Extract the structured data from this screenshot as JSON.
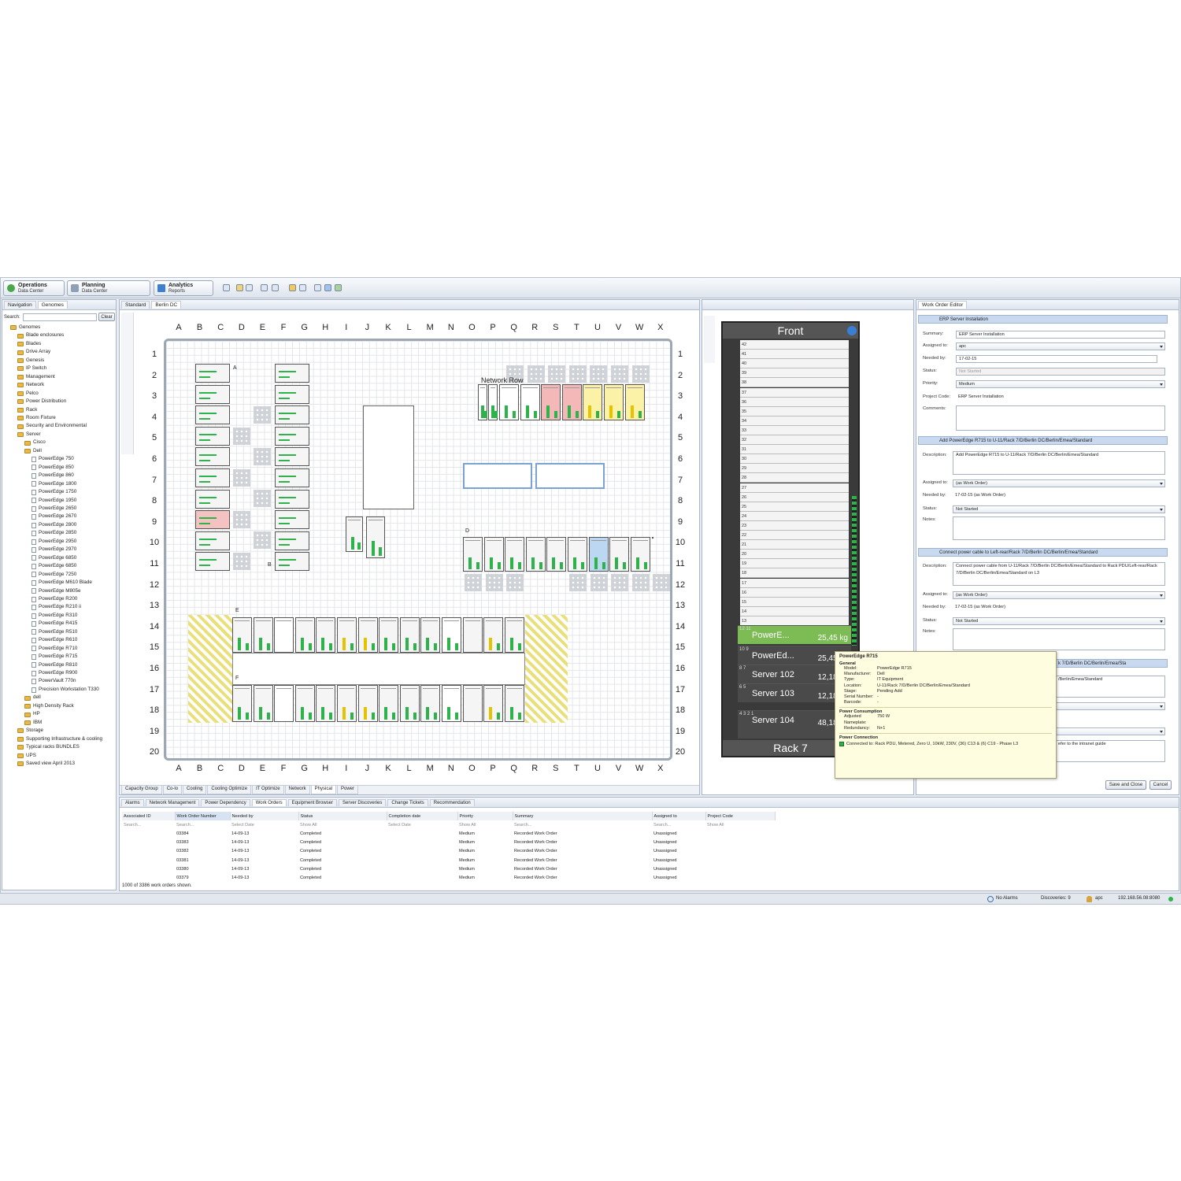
{
  "toolbar": {
    "perspectives": [
      {
        "title": "Operations",
        "sub": "Data Center"
      },
      {
        "title": "Planning",
        "sub": "Data Center"
      },
      {
        "title": "Analytics",
        "sub": "Reports"
      }
    ]
  },
  "nav": {
    "tabs": [
      "Navigation",
      "Genomes"
    ],
    "search_label": "Search:",
    "clear": "Clear",
    "tree": [
      {
        "l": "Genomes",
        "d": 0,
        "t": "f"
      },
      {
        "l": "Blade enclosures",
        "d": 1,
        "t": "f"
      },
      {
        "l": "Blades",
        "d": 1,
        "t": "f"
      },
      {
        "l": "Drive Array",
        "d": 1,
        "t": "f"
      },
      {
        "l": "Genesis",
        "d": 1,
        "t": "f"
      },
      {
        "l": "IP Switch",
        "d": 1,
        "t": "f"
      },
      {
        "l": "Management",
        "d": 1,
        "t": "f"
      },
      {
        "l": "Network",
        "d": 1,
        "t": "f"
      },
      {
        "l": "Pelco",
        "d": 1,
        "t": "f"
      },
      {
        "l": "Power Distribution",
        "d": 1,
        "t": "f"
      },
      {
        "l": "Rack",
        "d": 1,
        "t": "f"
      },
      {
        "l": "Room Fixture",
        "d": 1,
        "t": "f"
      },
      {
        "l": "Security and Environmental",
        "d": 1,
        "t": "f"
      },
      {
        "l": "Server",
        "d": 1,
        "t": "f"
      },
      {
        "l": "Cisco",
        "d": 2,
        "t": "f"
      },
      {
        "l": "Dell",
        "d": 2,
        "t": "f"
      },
      {
        "l": "PowerEdge 750",
        "d": 3,
        "t": "d"
      },
      {
        "l": "PowerEdge 850",
        "d": 3,
        "t": "d"
      },
      {
        "l": "PowerEdge 860",
        "d": 3,
        "t": "d"
      },
      {
        "l": "PowerEdge 1800",
        "d": 3,
        "t": "d"
      },
      {
        "l": "PowerEdge 1750",
        "d": 3,
        "t": "d"
      },
      {
        "l": "PowerEdge 1950",
        "d": 3,
        "t": "d"
      },
      {
        "l": "PowerEdge 2650",
        "d": 3,
        "t": "d"
      },
      {
        "l": "PowerEdge 2670",
        "d": 3,
        "t": "d"
      },
      {
        "l": "PowerEdge 2800",
        "d": 3,
        "t": "d"
      },
      {
        "l": "PowerEdge 2850",
        "d": 3,
        "t": "d"
      },
      {
        "l": "PowerEdge 2950",
        "d": 3,
        "t": "d"
      },
      {
        "l": "PowerEdge 2970",
        "d": 3,
        "t": "d"
      },
      {
        "l": "PowerEdge 6850",
        "d": 3,
        "t": "d"
      },
      {
        "l": "PowerEdge 6850",
        "d": 3,
        "t": "d"
      },
      {
        "l": "PowerEdge 7250",
        "d": 3,
        "t": "d"
      },
      {
        "l": "PowerEdge M610 Blade",
        "d": 3,
        "t": "d"
      },
      {
        "l": "PowerEdge M805e",
        "d": 3,
        "t": "d"
      },
      {
        "l": "PowerEdge R200",
        "d": 3,
        "t": "d"
      },
      {
        "l": "PowerEdge R210 ii",
        "d": 3,
        "t": "d"
      },
      {
        "l": "PowerEdge R310",
        "d": 3,
        "t": "d"
      },
      {
        "l": "PowerEdge R415",
        "d": 3,
        "t": "d"
      },
      {
        "l": "PowerEdge R510",
        "d": 3,
        "t": "d"
      },
      {
        "l": "PowerEdge R610",
        "d": 3,
        "t": "d"
      },
      {
        "l": "PowerEdge R710",
        "d": 3,
        "t": "d"
      },
      {
        "l": "PowerEdge R715",
        "d": 3,
        "t": "d"
      },
      {
        "l": "PowerEdge R810",
        "d": 3,
        "t": "d"
      },
      {
        "l": "PowerEdge R900",
        "d": 3,
        "t": "d"
      },
      {
        "l": "PowerVault 770n",
        "d": 3,
        "t": "d"
      },
      {
        "l": "Precision Workstation T330",
        "d": 3,
        "t": "d"
      },
      {
        "l": "dell",
        "d": 2,
        "t": "f"
      },
      {
        "l": "High Density Rack",
        "d": 2,
        "t": "f"
      },
      {
        "l": "HP",
        "d": 2,
        "t": "f"
      },
      {
        "l": "IBM",
        "d": 2,
        "t": "f"
      },
      {
        "l": "Storage",
        "d": 1,
        "t": "f"
      },
      {
        "l": "Supporting Infrastructure & cooling",
        "d": 1,
        "t": "f"
      },
      {
        "l": "Typical racks BUNDLES",
        "d": 1,
        "t": "f"
      },
      {
        "l": "UPS",
        "d": 1,
        "t": "f"
      },
      {
        "l": "Saved view April 2013",
        "d": 1,
        "t": "f"
      }
    ]
  },
  "editor": {
    "tabs": [
      "Standard",
      "Berlin DC"
    ],
    "columns": [
      "A",
      "B",
      "C",
      "D",
      "E",
      "F",
      "G",
      "H",
      "I",
      "J",
      "K",
      "L",
      "M",
      "N",
      "O",
      "P",
      "Q",
      "R",
      "S",
      "T",
      "U",
      "V",
      "W",
      "X"
    ],
    "rows": [
      "1",
      "2",
      "3",
      "4",
      "5",
      "6",
      "7",
      "8",
      "9",
      "10",
      "11",
      "12",
      "13",
      "14",
      "15",
      "16",
      "17",
      "18",
      "19",
      "20"
    ],
    "row_labels": {
      "a": "A",
      "b": "B",
      "c": "C",
      "d": "D",
      "e": "E",
      "f": "F"
    },
    "network_row": "Network Row",
    "bottom_tabs": [
      "Capacity Group",
      "Co-lo",
      "Cooling",
      "Cooling Optimize",
      "IT Optimize",
      "Network",
      "Physical",
      "Power"
    ]
  },
  "rack": {
    "header": "Front",
    "footer": "Rack 7",
    "units": [
      "42",
      "41",
      "40",
      "39",
      "38",
      "37",
      "36",
      "35",
      "34",
      "33",
      "32",
      "31",
      "30",
      "29",
      "28",
      "27",
      "26",
      "25",
      "24",
      "23",
      "22",
      "21",
      "20",
      "19",
      "18",
      "17",
      "16",
      "15",
      "14",
      "13"
    ],
    "servers": [
      {
        "name": "PowerE...",
        "weight": "25,45 kg",
        "units": "12 11",
        "color": "#7dbb55"
      },
      {
        "name": "PowerEd...",
        "weight": "25,45 kg",
        "units": "10 9",
        "color": "#4a4a4a"
      },
      {
        "name": "Server 102",
        "weight": "12,18 kg",
        "units": "8 7",
        "color": "#4a4a4a"
      },
      {
        "name": "Server 103",
        "weight": "12,18 kg",
        "units": "6 5",
        "color": "#4a4a4a"
      },
      {
        "name": "Server 104",
        "weight": "48,18 kg",
        "units": "4 3 2 1",
        "color": "#4a4a4a"
      }
    ]
  },
  "tooltip": {
    "title": "PowerEdge R715",
    "general": "General",
    "fields": [
      {
        "k": "Model:",
        "v": "PowerEdge R715"
      },
      {
        "k": "Manufacturer:",
        "v": "Dell"
      },
      {
        "k": "Type:",
        "v": "IT Equipment"
      },
      {
        "k": "Location:",
        "v": "U-11/Rack 7/D/Berlin DC/Berlin/Emea/Standard"
      },
      {
        "k": "Stage:",
        "v": "Pending Add"
      },
      {
        "k": "Serial Number:",
        "v": "-"
      },
      {
        "k": "Barcode:",
        "v": "-"
      }
    ],
    "power_consumption": "Power Consumption",
    "power_fields": [
      {
        "k": "Adjusted Nameplate:",
        "v": "750 W"
      },
      {
        "k": "Redundancy:",
        "v": "N+1"
      }
    ],
    "power_connection": "Power Connection",
    "connection": "Connected to: Rack PDU, Metered, Zero U, 10kW, 230V, (36) C13 & (6) C19 - Phase L3"
  },
  "work_order_editor": {
    "tab": "Work Order Editor",
    "section1": "ERP Server Installation",
    "summary_label": "Summary:",
    "summary": "ERP Server Installation",
    "assigned_label": "Assigned to:",
    "assigned": "apc",
    "needed_label": "Needed by:",
    "needed": "17-02-15",
    "status_label": "Status:",
    "status": "Not Started",
    "priority_label": "Priority:",
    "priority": "Medium",
    "project_label": "Project Code:",
    "project": "ERP Server Installation",
    "comments_label": "Comments:",
    "section2": "Add PowerEdge R715 to U-11/Rack 7/D/Berlin DC/Berlin/Emea/Standard",
    "desc_label": "Description:",
    "desc2": "Add PowerEdge R715 to U-11/Rack 7/D/Berlin DC/Berlin/Emea/Standard",
    "assigned2": "(as Work Order)",
    "needed2": "17-02-15 (as Work Order)",
    "status2": "Not Started",
    "notes_label": "Notes:",
    "section3": "Connect power cable to Left-rear/Rack 7/D/Berlin DC/Berlin/Emea/Standard",
    "desc3": "Connect power cable from U-11/Rack 7/D/Berlin DC/Berlin/Emea/Standard to Rack PDU/Left-rear/Rack 7/D/Berlin DC/Berlin/Emea/Standard on L3",
    "section4_tail": "k 7/D/Berlin DC/Berlin/Emea/Sta",
    "desc4_tail": "/Berlin/Emea/Standard",
    "note4_tail": "efer to the intranet guide",
    "save_close": "Save and Close",
    "cancel": "Cancel"
  },
  "bottom": {
    "tabs": [
      "Alarms",
      "Network Management",
      "Power Dependency",
      "Work Orders",
      "Equipment Browser",
      "Server Discoveries",
      "Change Tickets",
      "Recommendation"
    ],
    "columns": [
      "Associated ID",
      "Work Order Number",
      "Needed by",
      "Status",
      "Completion date",
      "Priority",
      "Summary",
      "Assigned to",
      "Project Code"
    ],
    "filters": [
      "Search...",
      "Search...",
      "Select Date",
      "Show All",
      "Select Date",
      "Show All",
      "Search...",
      "Search...",
      "Show All"
    ],
    "rows": [
      [
        "",
        "03384",
        "14-09-13",
        "Completed",
        "",
        "Medium",
        "Recorded Work Order",
        "Unassigned",
        ""
      ],
      [
        "",
        "03383",
        "14-09-13",
        "Completed",
        "",
        "Medium",
        "Recorded Work Order",
        "Unassigned",
        ""
      ],
      [
        "",
        "03382",
        "14-09-13",
        "Completed",
        "",
        "Medium",
        "Recorded Work Order",
        "Unassigned",
        ""
      ],
      [
        "",
        "03381",
        "14-09-13",
        "Completed",
        "",
        "Medium",
        "Recorded Work Order",
        "Unassigned",
        ""
      ],
      [
        "",
        "03380",
        "14-09-13",
        "Completed",
        "",
        "Medium",
        "Recorded Work Order",
        "Unassigned",
        ""
      ],
      [
        "",
        "03379",
        "14-09-13",
        "Completed",
        "",
        "Medium",
        "Recorded Work Order",
        "Unassigned",
        ""
      ]
    ],
    "footer": "1000 of 3386 work orders shown."
  },
  "statusbar": {
    "alarms": "No Alarms",
    "discoveries": "Discoveries: 9",
    "user": "apc",
    "server": "192.168.56.08:8080"
  }
}
